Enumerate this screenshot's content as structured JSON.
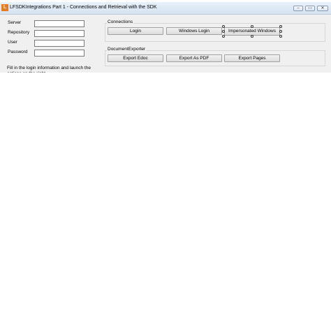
{
  "window": {
    "title": "LFSDKIntegrations Part 1 - Connections and Retrieval with the SDK",
    "app_icon_letter": "L",
    "controls": {
      "minimize": "–",
      "maximize": "▭",
      "close": "✕"
    }
  },
  "login_form": {
    "server_label": "Server",
    "repository_label": "Repository",
    "user_label": "User",
    "password_label": "Password",
    "server_value": "",
    "repository_value": "",
    "user_value": "",
    "password_value": "",
    "info_text": "Fill in the login information and launch the actions on the right"
  },
  "connections": {
    "title": "Connections",
    "login_button": "Login",
    "windows_login_button": "Windows Login",
    "impersonated_windows_button": "Impersonated Windows"
  },
  "document_exporter": {
    "title": "DocumentExporter",
    "export_edoc_button": "Export Edoc",
    "export_pdf_button": "Export As PDF",
    "export_pages_button": "Export Pages"
  }
}
